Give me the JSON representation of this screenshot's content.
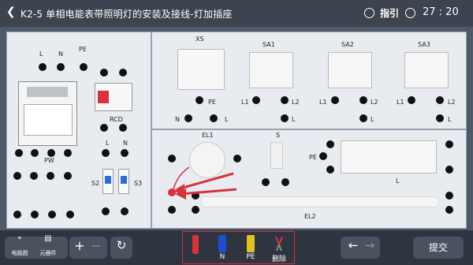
{
  "header": {
    "back_icon": "chevron-left",
    "title": "K2-5 单相电能表带照明灯的安装及接线-灯加插座",
    "guide_label": "指引",
    "timer": "27 : 20"
  },
  "left_panel": {
    "terminals_top": {
      "l": "L",
      "n": "N",
      "pe": "PE"
    },
    "meter_label": "PW",
    "rcd_label": "RCD",
    "rcd_terms": {
      "l": "L",
      "n": "N"
    },
    "s2_label": "S2",
    "s3_label": "S3"
  },
  "socket": {
    "label": "XS",
    "pe": "PE",
    "n": "N",
    "l": "L"
  },
  "switches": [
    {
      "label": "SA1",
      "l1": "L1",
      "l2": "L2",
      "l": "L"
    },
    {
      "label": "SA2",
      "l1": "L1",
      "l2": "L2",
      "l": "L"
    },
    {
      "label": "SA3",
      "l1": "L1",
      "l2": "L2",
      "l": "L"
    }
  ],
  "lamp": {
    "el1": "EL1",
    "s": "S",
    "pe": "PE",
    "l": "L",
    "el2": "EL2"
  },
  "toolbar": {
    "circuit_label": "电路图",
    "components_label": "元器件",
    "zoom_in": "+",
    "zoom_out": "−",
    "refresh": "↻",
    "tools": [
      {
        "name": "red-wire",
        "label": ""
      },
      {
        "name": "n-wire",
        "label": "N"
      },
      {
        "name": "pe-wire",
        "label": "PE"
      },
      {
        "name": "delete",
        "label": "删除"
      }
    ],
    "nav_back": "←",
    "nav_forward": "→",
    "submit_label": "提交"
  },
  "colors": {
    "accent_red": "#d9323a",
    "panel_bg": "#e8ecf1",
    "wire_n": "#1f4fd1",
    "wire_pe": "#e0c21e"
  }
}
